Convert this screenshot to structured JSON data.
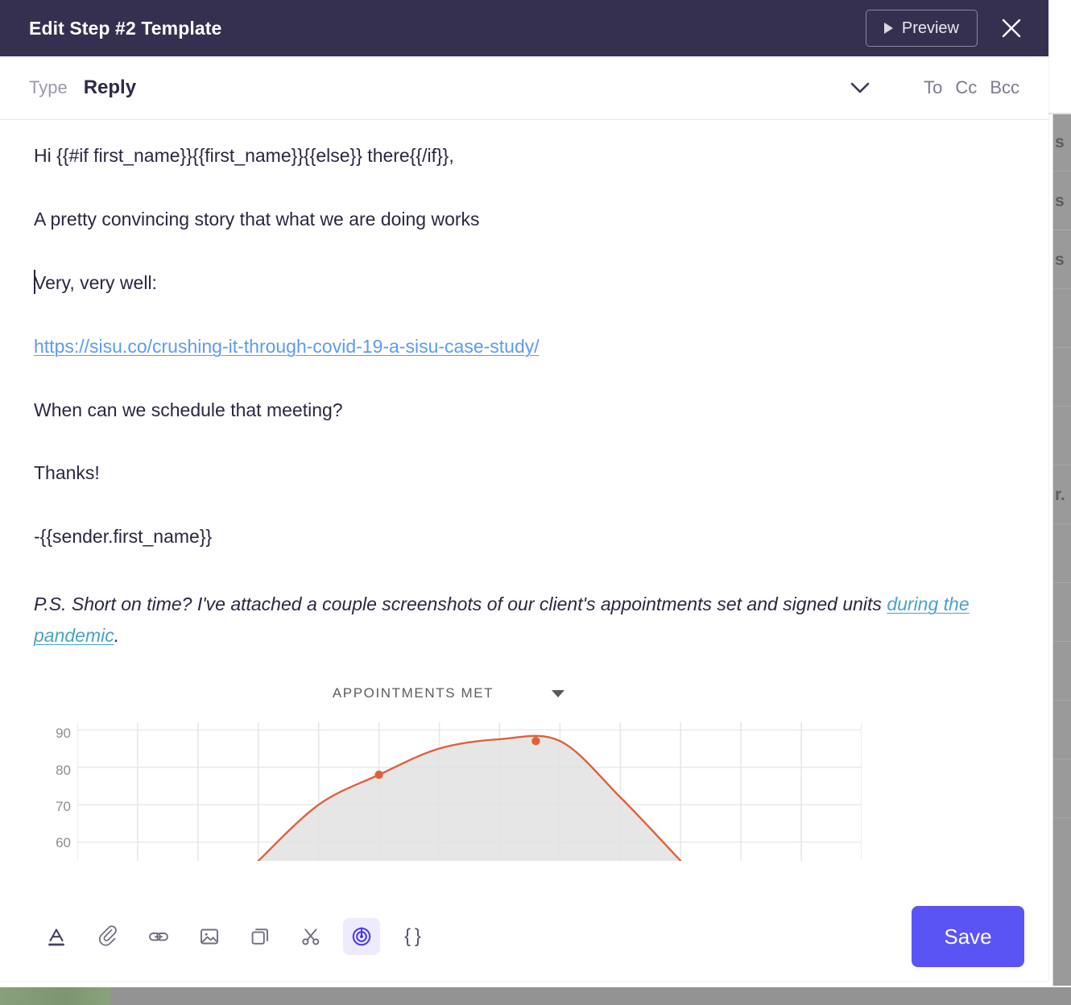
{
  "header": {
    "title": "Edit Step #2 Template",
    "preview_label": "Preview",
    "close_icon": "close-icon",
    "background_color": "#353050"
  },
  "type_row": {
    "label": "Type",
    "value": "Reply",
    "chevron_icon": "chevron-down-icon",
    "recipients": [
      "To",
      "Cc",
      "Bcc"
    ]
  },
  "editor": {
    "paragraphs": [
      "Hi {{#if first_name}}{{first_name}}{{else}} there{{/if}},",
      "A pretty convincing story that what we are doing works",
      "Very, very well:",
      "When can we schedule that meeting?",
      "Thanks!",
      "-{{sender.first_name}}"
    ],
    "link_url_text": "https://sisu.co/crushing-it-through-covid-19-a-sisu-case-study/",
    "ps_lead": "P.S. Short on time? I've attached a couple screenshots of our client's appointments set and signed units ",
    "ps_link": "during the pandemic",
    "ps_tail": ".",
    "link_color": "#5b9bf5",
    "inline_link_color": "#4aa3c4"
  },
  "chart_data": {
    "type": "area",
    "title": "APPOINTMENTS MET",
    "xlabel": "",
    "ylabel": "",
    "ylim": [
      55,
      92
    ],
    "yticks": [
      90,
      80,
      70,
      60
    ],
    "grid": true,
    "legend": "none",
    "line_color": "#e0603a",
    "fill_color": "#e2e2e2",
    "x": [
      0,
      1,
      2,
      3,
      4,
      5,
      6,
      7,
      8,
      9,
      10,
      11,
      12,
      13
    ],
    "values": [
      null,
      null,
      null,
      55,
      70,
      78,
      85,
      87.5,
      87,
      72,
      55,
      null,
      null,
      null
    ],
    "markers": [
      {
        "x": 5,
        "y": 78
      },
      {
        "x": 7.6,
        "y": 87
      }
    ],
    "dropdown_icon": "chevron-down-icon"
  },
  "toolbar": {
    "items": [
      {
        "name": "text-format-icon",
        "label": "A"
      },
      {
        "name": "paperclip-icon",
        "label": ""
      },
      {
        "name": "link-icon",
        "label": ""
      },
      {
        "name": "image-icon",
        "label": ""
      },
      {
        "name": "duplicate-icon",
        "label": ""
      },
      {
        "name": "scissors-icon",
        "label": ""
      },
      {
        "name": "tracking-icon",
        "label": ""
      },
      {
        "name": "braces-icon",
        "label": "{ }"
      }
    ],
    "active_index": 6,
    "active_color": "#4b3df0",
    "save_label": "Save",
    "save_color": "#5b54f5"
  },
  "background": {
    "rows": [
      "s",
      "s",
      "s",
      "",
      "",
      "",
      "r.",
      "",
      "",
      "",
      "",
      ""
    ],
    "progress_color": "#7d9570"
  }
}
